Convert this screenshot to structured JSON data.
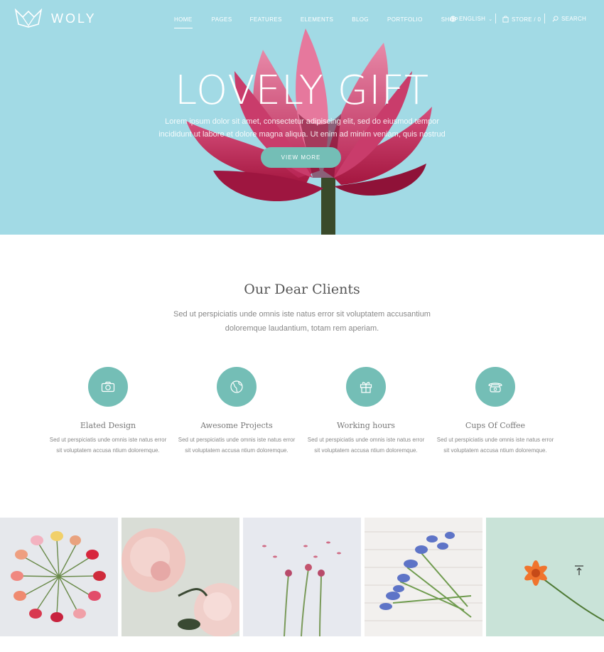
{
  "brand": {
    "name": "WOLY"
  },
  "nav": {
    "items": [
      {
        "label": "HOME",
        "active": true
      },
      {
        "label": "PAGES",
        "active": false
      },
      {
        "label": "FEATURES",
        "active": false
      },
      {
        "label": "ELEMENTS",
        "active": false
      },
      {
        "label": "BLOG",
        "active": false
      },
      {
        "label": "PORTFOLIO",
        "active": false
      },
      {
        "label": "SHOP",
        "active": false
      }
    ],
    "language": "ENGLISH",
    "store": "STORE / 0",
    "search": "SEARCH"
  },
  "hero": {
    "title": "LOVELY GIFT",
    "text": "Lorem ipsum dolor sit amet, consectetur adipiscing elit, sed do eiusmod tempor incididunt ut labore et dolore magna aliqua. Ut enim ad minim veniam, quis nostrud",
    "button": "VIEW MORE"
  },
  "clients": {
    "title": "Our Dear Clients",
    "subtitle": "Sed ut perspiciatis unde omnis iste natus error sit voluptatem accusantium doloremque laudantium, totam rem aperiam.",
    "features": [
      {
        "icon": "camera-icon",
        "title": "Elated Design",
        "text": "Sed ut perspiciatis unde omnis iste natus error sit voluptatem accusa ntium doloremque."
      },
      {
        "icon": "globe-icon",
        "title": "Awesome Projects",
        "text": "Sed ut perspiciatis unde omnis iste natus error sit voluptatem accusa ntium doloremque."
      },
      {
        "icon": "gift-icon",
        "title": "Working hours",
        "text": "Sed ut perspiciatis unde omnis iste natus error sit voluptatem accusa ntium doloremque."
      },
      {
        "icon": "phone-icon",
        "title": "Cups Of Coffee",
        "text": "Sed ut perspiciatis unde omnis iste natus error sit voluptatem accusa ntium doloremque."
      }
    ]
  },
  "gallery": {
    "items": [
      {
        "subject": "tulip-circle"
      },
      {
        "subject": "pink-peonies"
      },
      {
        "subject": "white-flowers"
      },
      {
        "subject": "blue-muscari"
      },
      {
        "subject": "orange-gerbera"
      }
    ]
  },
  "colors": {
    "hero_bg": "#a2dae5",
    "accent": "#74beb6",
    "white": "#ffffff"
  }
}
